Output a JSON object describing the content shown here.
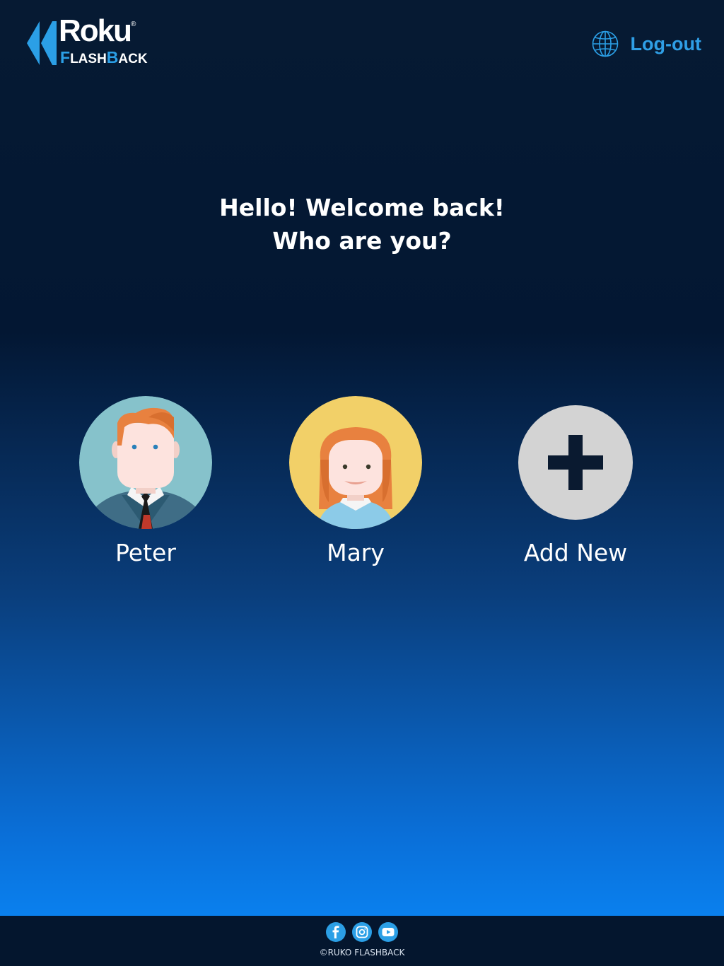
{
  "header": {
    "logo": {
      "brand": "Roku",
      "trademark": "®",
      "subbrand_parts": [
        {
          "cap": "F",
          "rest": "LASH"
        },
        {
          "cap": "B",
          "rest": "ACK"
        }
      ]
    },
    "logout": {
      "label": "Log-out",
      "icon": "globe-icon"
    }
  },
  "welcome": {
    "line1": "Hello! Welcome back!",
    "line2": "Who are you?"
  },
  "profiles": [
    {
      "name": "Peter",
      "avatar": "peter-avatar"
    },
    {
      "name": "Mary",
      "avatar": "mary-avatar"
    },
    {
      "name": "Add New",
      "avatar": "plus-icon"
    }
  ],
  "footer": {
    "social": [
      "facebook-icon",
      "instagram-icon",
      "youtube-icon"
    ],
    "copyright": "©RUKO FLASHBACK"
  },
  "colors": {
    "accent": "#2b9fe6",
    "background_top": "#061a33",
    "background_bottom": "#0a80ee",
    "footer": "#04162e",
    "add_circle": "#d3d3d3"
  }
}
